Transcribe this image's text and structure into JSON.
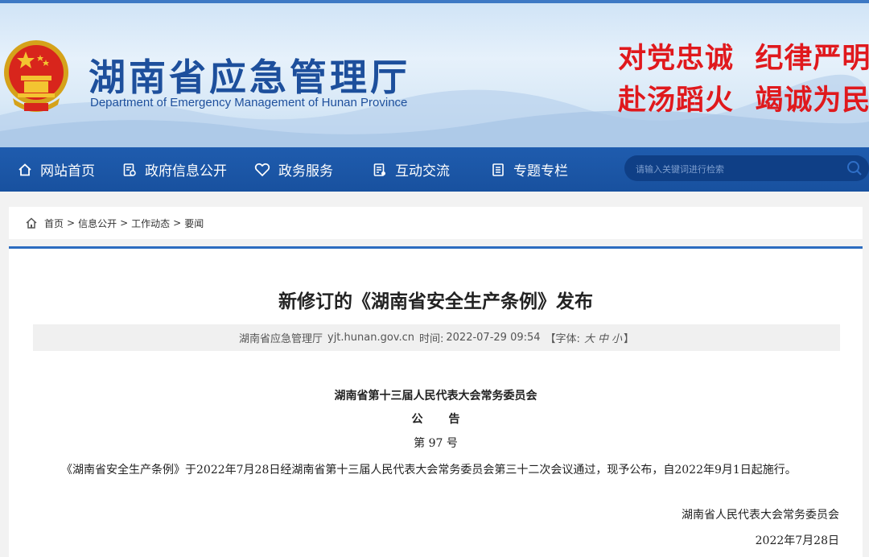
{
  "header": {
    "title_cn": "湖南省应急管理厅",
    "title_en": "Department of Emergency Management of Hunan Province",
    "slogan_line1": "对党忠诚  纪律严明",
    "slogan_line2": "赴汤蹈火  竭诚为民",
    "emblem_icon": "national-emblem-icon"
  },
  "nav": {
    "items": [
      {
        "label": "网站首页",
        "icon": "home-icon"
      },
      {
        "label": "政府信息公开",
        "icon": "document-icon"
      },
      {
        "label": "政务服务",
        "icon": "heart-icon"
      },
      {
        "label": "互动交流",
        "icon": "chat-doc-icon"
      },
      {
        "label": "专题专栏",
        "icon": "list-doc-icon"
      }
    ],
    "search_placeholder": "请输入关键词进行检索"
  },
  "breadcrumb": {
    "items": [
      "首页",
      "信息公开",
      "工作动态",
      "要闻"
    ],
    "separator": ">"
  },
  "article": {
    "title": "新修订的《湖南省安全生产条例》发布",
    "source": "湖南省应急管理厅",
    "site": "yjt.hunan.gov.cn",
    "time_label": "时间:",
    "time": "2022-07-29 09:54",
    "fontsize_label": "【字体:",
    "fontsize_large": "大",
    "fontsize_medium": "中",
    "fontsize_small": "小",
    "fontsize_close": "】",
    "issuer": "湖南省第十三届人民代表大会常务委员会",
    "notice": "公告",
    "number": "第 97 号",
    "paragraph": "《湖南省安全生产条例》于2022年7月28日经湖南省第十三届人民代表大会常务委员会第三十二次会议通过，现予公布，自2022年9月1日起施行。",
    "signature": "湖南省人民代表大会常务委员会",
    "date": "2022年7月28日"
  },
  "colors": {
    "nav_bg": "#1f5cae",
    "brand_blue": "#1d4f9c",
    "slogan_red": "#e0191d",
    "accent_line": "#2b6cbf"
  }
}
